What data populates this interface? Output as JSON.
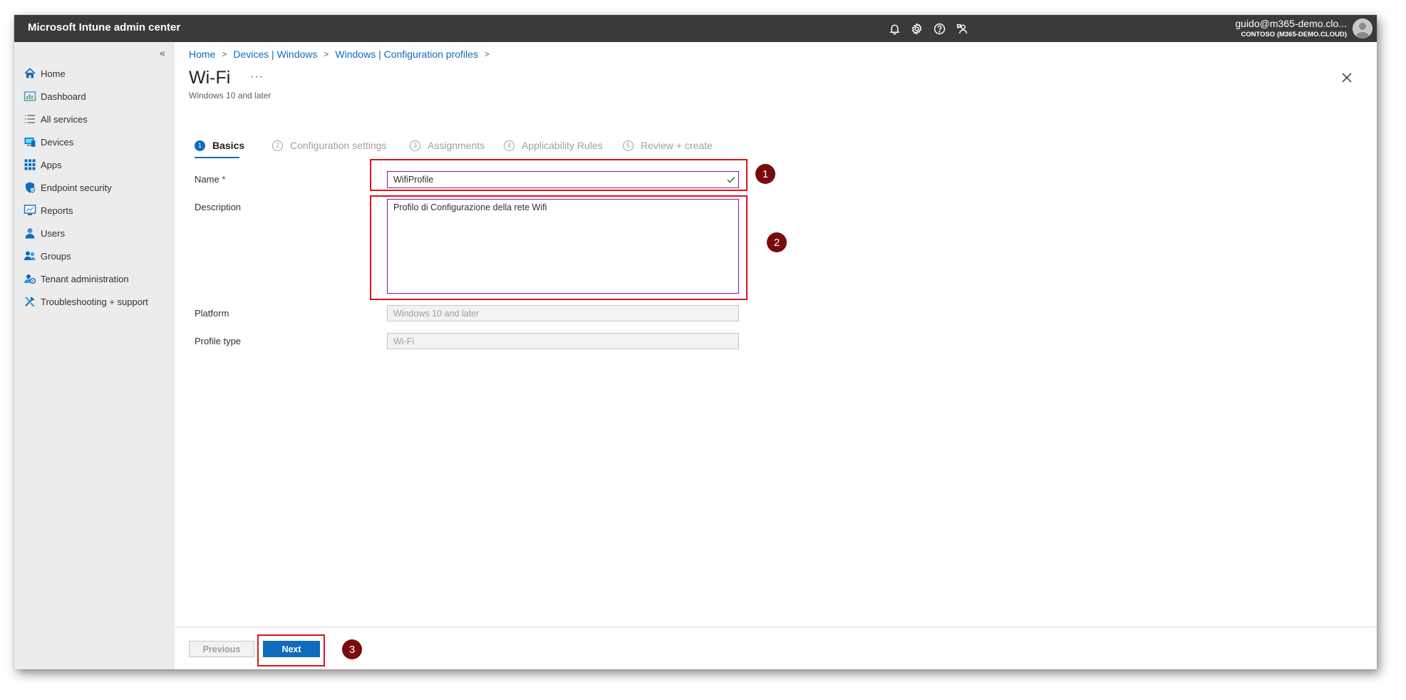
{
  "app": {
    "title": "Microsoft Intune admin center",
    "user_email": "guido@m365-demo.clo...",
    "user_tenant": "CONTOSO (M365-DEMO.CLOUD)",
    "top_icons": [
      "bell-icon",
      "gear-icon",
      "help-icon",
      "feedback-icon"
    ]
  },
  "sidebar": {
    "collapse_glyph": "«",
    "items": [
      {
        "label": "Home",
        "icon": "home-icon"
      },
      {
        "label": "Dashboard",
        "icon": "dashboard-icon"
      },
      {
        "label": "All services",
        "icon": "all-services-icon"
      },
      {
        "label": "Devices",
        "icon": "devices-icon"
      },
      {
        "label": "Apps",
        "icon": "apps-icon"
      },
      {
        "label": "Endpoint security",
        "icon": "shield-icon"
      },
      {
        "label": "Reports",
        "icon": "reports-icon"
      },
      {
        "label": "Users",
        "icon": "user-icon"
      },
      {
        "label": "Groups",
        "icon": "groups-icon"
      },
      {
        "label": "Tenant administration",
        "icon": "tenant-admin-icon"
      },
      {
        "label": "Troubleshooting + support",
        "icon": "troubleshoot-icon"
      }
    ]
  },
  "breadcrumb": {
    "items": [
      "Home",
      "Devices | Windows",
      "Windows | Configuration profiles"
    ],
    "separator": ">"
  },
  "page": {
    "title": "Wi-Fi",
    "more": "···",
    "subtitle": "Windows 10 and later"
  },
  "wizard": {
    "steps": [
      {
        "num": "1",
        "label": "Basics"
      },
      {
        "num": "2",
        "label": "Configuration settings"
      },
      {
        "num": "3",
        "label": "Assignments"
      },
      {
        "num": "4",
        "label": "Applicability Rules"
      },
      {
        "num": "5",
        "label": "Review + create"
      }
    ]
  },
  "form": {
    "name_label": "Name",
    "required_mark": "*",
    "name_value": "WifiProfile",
    "description_label": "Description",
    "description_value": "Profilo di Configurazione della rete Wifi",
    "platform_label": "Platform",
    "platform_value": "Windows 10 and later",
    "profile_type_label": "Profile type",
    "profile_type_value": "Wi-Fi"
  },
  "annotations": {
    "badges": [
      "1",
      "2",
      "3"
    ],
    "highlight_color": "#d9141f",
    "badge_color": "#7a0b0b"
  },
  "footer": {
    "previous_label": "Previous",
    "next_label": "Next"
  },
  "colors": {
    "accent": "#0f6cbd",
    "topbar": "#3a3a3a",
    "sidebar": "#ececec",
    "focus_border": "#881798",
    "valid_check": "#107c10"
  }
}
